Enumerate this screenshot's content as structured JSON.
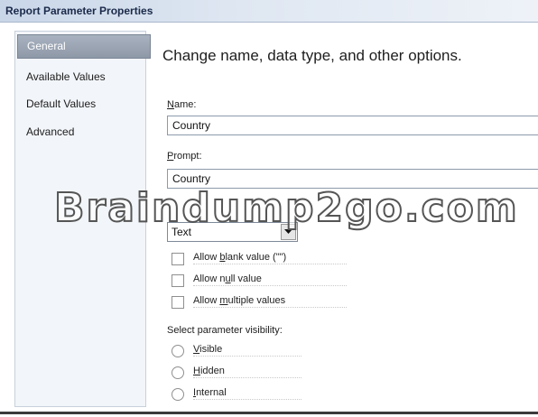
{
  "window": {
    "title": "Report Parameter Properties"
  },
  "nav": {
    "items": [
      {
        "label": "General",
        "selected": true
      },
      {
        "label": "Available Values",
        "selected": false
      },
      {
        "label": "Default Values",
        "selected": false
      },
      {
        "label": "Advanced",
        "selected": false
      }
    ]
  },
  "main": {
    "heading": "Change name, data type, and other options.",
    "name": {
      "label_u": "N",
      "label_rest": "ame:",
      "value": "Country"
    },
    "prompt": {
      "label_u": "P",
      "label_rest": "rompt:",
      "value": "Country"
    },
    "data_type": {
      "value": "Text"
    },
    "options": [
      {
        "pre": "Allow ",
        "u": "b",
        "post": "lank value (\"\")",
        "checked": false
      },
      {
        "pre": "Allow n",
        "u": "u",
        "post": "ll value",
        "checked": false
      },
      {
        "pre": "Allow ",
        "u": "m",
        "post": "ultiple values",
        "checked": false
      }
    ],
    "visibility": {
      "label": "Select parameter visibility:",
      "options": [
        {
          "u": "V",
          "rest": "isible",
          "selected": false
        },
        {
          "u": "H",
          "rest": "idden",
          "selected": false
        },
        {
          "u": "I",
          "rest": "nternal",
          "selected": false
        }
      ]
    }
  },
  "watermark": "Braindump2go.com",
  "colors": {
    "selected_nav": "#9aa4b2",
    "titlebar": "#dfe7f2"
  }
}
